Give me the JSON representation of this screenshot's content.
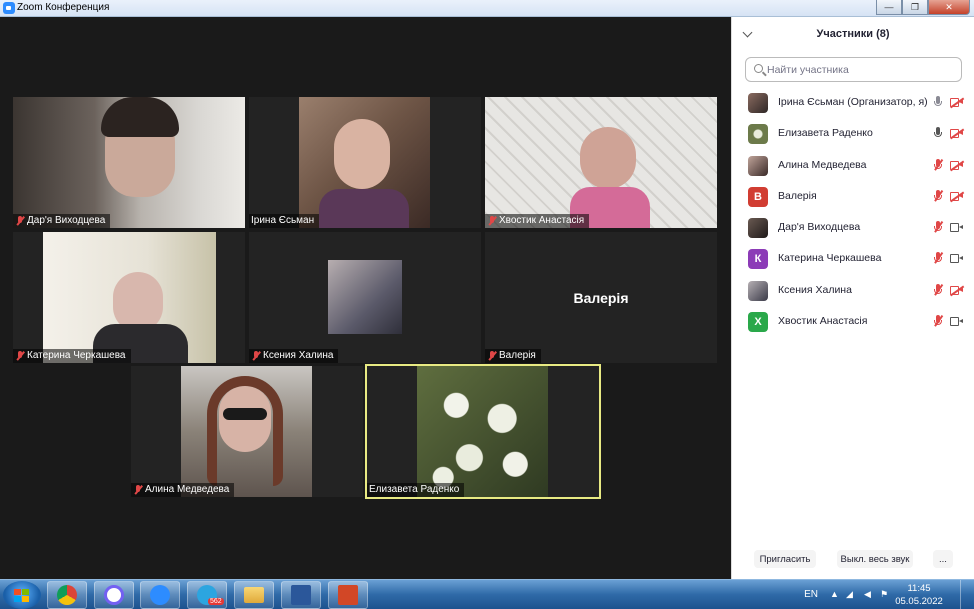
{
  "window": {
    "title": "Zoom Конференция",
    "minimize_glyph": "—",
    "maximize_glyph": "❐",
    "close_glyph": "✕"
  },
  "tiles": [
    {
      "name": "Дар'я Виходцева",
      "muted": true
    },
    {
      "name": "Ірина Єсьман",
      "muted": false
    },
    {
      "name": "Хвостик Анастасія",
      "muted": true
    },
    {
      "name": "Катерина Черкашева",
      "muted": true
    },
    {
      "name": "Ксения Халина",
      "muted": true
    },
    {
      "name": "Валерія",
      "muted": true,
      "center_text": "Валерія"
    },
    {
      "name": "Алина Медведева",
      "muted": true
    },
    {
      "name": "Елизавета Раденко",
      "muted": false,
      "active_speaker": true
    }
  ],
  "panel": {
    "title": "Участники (8)",
    "search_placeholder": "Найти участника",
    "participants": [
      {
        "name": "Ірина Єсьман (Организатор, я)",
        "avatar": "photo",
        "mic": "on",
        "video": "off"
      },
      {
        "name": "Елизавета Раденко",
        "avatar": "photo",
        "mic": "on",
        "video": "off"
      },
      {
        "name": "Алина Медведева",
        "avatar": "photo",
        "mic": "off",
        "video": "off"
      },
      {
        "name": "Валерія",
        "avatar": "letter",
        "letter": "В",
        "avatar_color": "#d13d32",
        "mic": "off",
        "video": "off"
      },
      {
        "name": "Дар'я Виходцева",
        "avatar": "photo",
        "mic": "off",
        "video": "on"
      },
      {
        "name": "Катерина Черкашева",
        "avatar": "letter",
        "letter": "К",
        "avatar_color": "#8c3bb7",
        "mic": "off",
        "video": "on"
      },
      {
        "name": "Ксения Халина",
        "avatar": "photo",
        "mic": "off",
        "video": "off"
      },
      {
        "name": "Хвостик Анастасія",
        "avatar": "letter",
        "letter": "Х",
        "avatar_color": "#2aa84a",
        "mic": "off",
        "video": "on"
      }
    ],
    "invite_label": "Пригласить",
    "mute_all_label": "Выкл. весь звук",
    "more_label": "..."
  },
  "taskbar": {
    "apps": [
      "chrome-icon",
      "viber-icon",
      "zoom-icon",
      "telegram-icon",
      "folder-icon",
      "word-icon",
      "powerpoint-icon"
    ],
    "telegram_badge": "562",
    "language": "EN",
    "time": "11:45",
    "date": "05.05.2022"
  },
  "colors": {
    "muted_red": "#e04747",
    "active_border": "#e8ea83",
    "zoom_blue": "#2d8cff"
  }
}
